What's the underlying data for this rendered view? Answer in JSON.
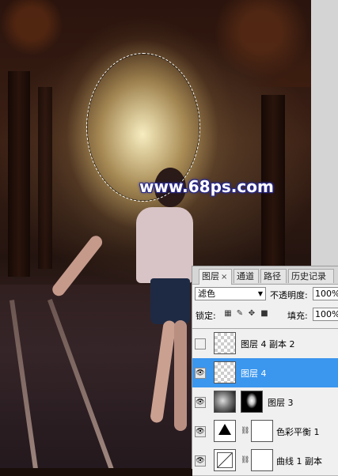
{
  "watermark": "www.68ps.com",
  "panel": {
    "tabs": [
      {
        "label": "图层",
        "close": "×",
        "active": true
      },
      {
        "label": "通道",
        "active": false
      },
      {
        "label": "路径",
        "active": false
      },
      {
        "label": "历史记录",
        "active": false
      }
    ],
    "blend_mode": "滤色",
    "opacity_label": "不透明度:",
    "opacity_value": "100%",
    "lock_label": "锁定:",
    "fill_label": "填充:",
    "fill_value": "100%",
    "layers": [
      {
        "name": "图层 4 副本 2",
        "visible": false,
        "selected": false
      },
      {
        "name": "图层 4",
        "visible": true,
        "selected": true
      },
      {
        "name": "图层 3",
        "visible": true,
        "selected": false
      },
      {
        "name": "色彩平衡 1",
        "visible": true,
        "selected": false
      },
      {
        "name": "曲线 1 副本",
        "visible": true,
        "selected": false
      }
    ]
  },
  "colors": {
    "selected_layer": "#3b96ee",
    "panel_bg": "#f0f0f0",
    "watermark_outline": "#2a2a8a"
  }
}
